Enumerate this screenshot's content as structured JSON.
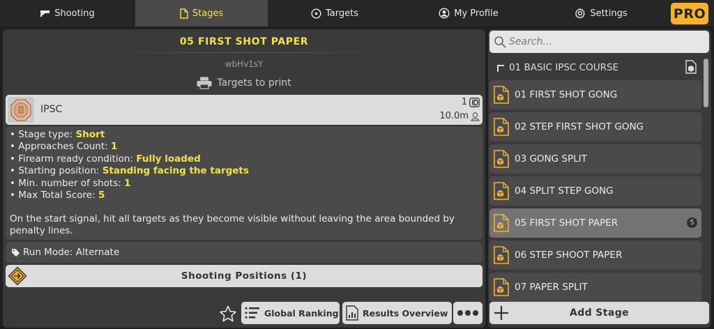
{
  "nav": {
    "tabs": [
      {
        "label": "Shooting",
        "icon": "gun-icon"
      },
      {
        "label": "Stages",
        "icon": "document-icon"
      },
      {
        "label": "Targets",
        "icon": "target-icon"
      },
      {
        "label": "My Profile",
        "icon": "user-circle-icon"
      },
      {
        "label": "Settings",
        "icon": "gear-icon"
      }
    ],
    "active_tab": "Stages",
    "pro_label": "PRO"
  },
  "stage": {
    "title": "05 FIRST SHOT PAPER",
    "code": "wbHv1sY",
    "print_label": "Targets to print",
    "target": {
      "name": "IPSC",
      "count": "1",
      "distance": "10.0m"
    },
    "details": [
      {
        "label": "• Stage type: ",
        "value": "Short"
      },
      {
        "label": "• Approaches Count: ",
        "value": "1"
      },
      {
        "label": "• Firearm ready condition: ",
        "value": "Fully loaded"
      },
      {
        "label": "• Starting position: ",
        "value": "Standing facing the targets"
      },
      {
        "label": "• Min. number of shots: ",
        "value": "1"
      },
      {
        "label": "• Max Total Score: ",
        "value": "5"
      }
    ],
    "description": "On the start signal, hit all targets as they become visible without leaving the area bounded by penalty lines.",
    "run_mode": "Run Mode: Alternate",
    "shooting_positions": "Shooting Positions (1)"
  },
  "actions": {
    "global_ranking": "Global Ranking",
    "results_overview": "Results Overview"
  },
  "sidebar": {
    "search_placeholder": "Search...",
    "course": "01 BASIC IPSC COURSE",
    "items": [
      {
        "label": "01 FIRST SHOT GONG"
      },
      {
        "label": "02 STEP FIRST SHOT GONG"
      },
      {
        "label": "03 GONG SPLIT"
      },
      {
        "label": "04 SPLIT STEP GONG"
      },
      {
        "label": "05 FIRST SHOT PAPER",
        "badge": "5"
      },
      {
        "label": "06 STEP SHOOT PAPER"
      },
      {
        "label": "07 PAPER SPLIT"
      }
    ],
    "selected_index": 4,
    "add_stage": "Add Stage"
  },
  "colors": {
    "accent": "#f0e24a",
    "pro": "#f5b22f",
    "stage_icon": "#f5b22f"
  }
}
